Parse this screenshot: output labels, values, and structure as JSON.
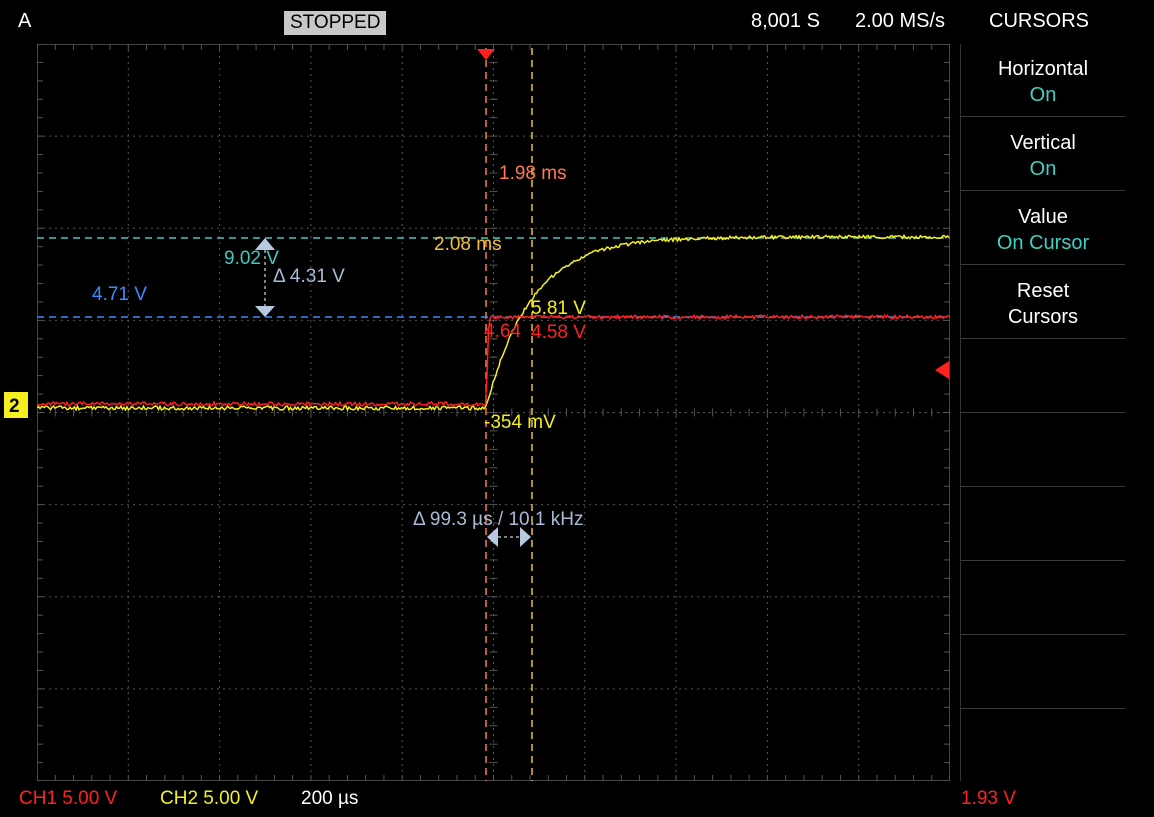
{
  "header": {
    "trigger_mode": "A",
    "status": "STOPPED",
    "samples": "8,001 S",
    "sample_rate": "2.00 MS/s",
    "menu_title": "CURSORS"
  },
  "menu": {
    "items": [
      {
        "title": "Horizontal",
        "value": "On"
      },
      {
        "title": "Vertical",
        "value": "On"
      },
      {
        "title": "Value",
        "value": "On Cursor"
      },
      {
        "title": "Reset",
        "value": "Cursors"
      }
    ]
  },
  "cursors": {
    "h1_time": "1.98 ms",
    "h2_time": "2.08 ms",
    "v1_value": "9.02 V",
    "v2_value": "4.71 V",
    "v_delta": "Δ 4.31 V",
    "h_delta": "Δ 99.3 µs / 10.1 kHz",
    "ch2_at_h2": "5.81 V",
    "ch1_at_h1": "4.64",
    "ch1_at_h2": "4.58 V",
    "ch2_at_h1": "-354 mV"
  },
  "channel_marker": "2",
  "footer": {
    "ch1_scale": "CH1 5.00 V",
    "ch2_scale": "CH2 5.00 V",
    "timebase": "200 µs",
    "trigger_level": "1.93 V"
  },
  "colors": {
    "ch1": "#ff2020",
    "ch2": "#f5f01e",
    "h_cursor1": "#ff7a50",
    "h_cursor2": "#f0c040",
    "v_cursor1": "#3fc8c0",
    "v_cursor2": "#3b8cff",
    "delta": "#a8bcd8",
    "menu_value": "#3fd1c3"
  }
}
